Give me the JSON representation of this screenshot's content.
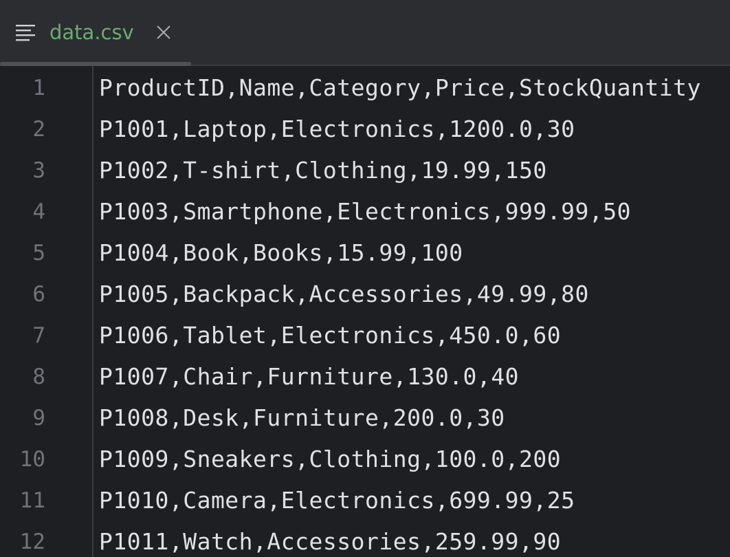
{
  "tab": {
    "filename": "data.csv",
    "file_icon": "lines-icon",
    "close_icon": "close-icon"
  },
  "colors": {
    "background": "#2b2d30",
    "editor_background": "#1e1f22",
    "tab_label": "#6aab73",
    "text": "#dfe1e5",
    "line_numbers": "#6f737a"
  },
  "editor": {
    "lines": [
      {
        "num": "1",
        "text": "ProductID,Name,Category,Price,StockQuantity"
      },
      {
        "num": "2",
        "text": "P1001,Laptop,Electronics,1200.0,30"
      },
      {
        "num": "3",
        "text": "P1002,T-shirt,Clothing,19.99,150"
      },
      {
        "num": "4",
        "text": "P1003,Smartphone,Electronics,999.99,50"
      },
      {
        "num": "5",
        "text": "P1004,Book,Books,15.99,100"
      },
      {
        "num": "6",
        "text": "P1005,Backpack,Accessories,49.99,80"
      },
      {
        "num": "7",
        "text": "P1006,Tablet,Electronics,450.0,60"
      },
      {
        "num": "8",
        "text": "P1007,Chair,Furniture,130.0,40"
      },
      {
        "num": "9",
        "text": "P1008,Desk,Furniture,200.0,30"
      },
      {
        "num": "10",
        "text": "P1009,Sneakers,Clothing,100.0,200"
      },
      {
        "num": "11",
        "text": "P1010,Camera,Electronics,699.99,25"
      },
      {
        "num": "12",
        "text": "P1011,Watch,Accessories,259.99,90"
      }
    ]
  }
}
